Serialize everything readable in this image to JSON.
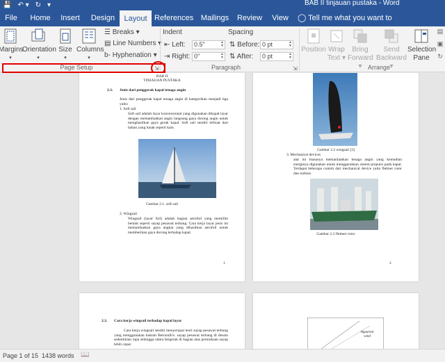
{
  "window": {
    "title": "BAB II tinjauan pustaka - Word"
  },
  "tabs": [
    {
      "label": "File"
    },
    {
      "label": "Home"
    },
    {
      "label": "Insert"
    },
    {
      "label": "Design"
    },
    {
      "label": "Layout"
    },
    {
      "label": "References"
    },
    {
      "label": "Mailings"
    },
    {
      "label": "Review"
    },
    {
      "label": "View"
    }
  ],
  "tellme": "Tell me what you want to do",
  "ribbon": {
    "page_setup": {
      "margins": "Margins",
      "orientation": "Orientation",
      "size": "Size",
      "columns": "Columns",
      "breaks": "Breaks",
      "line_numbers": "Line Numbers",
      "hyphenation": "Hyphenation",
      "label": "Page Setup"
    },
    "paragraph": {
      "indent": "Indent",
      "left_label": "Left:",
      "left_value": "0.5\"",
      "right_label": "Right:",
      "right_value": "0\"",
      "spacing": "Spacing",
      "before_label": "Before:",
      "before_value": "0 pt",
      "after_label": "After:",
      "after_value": "0 pt",
      "label": "Paragraph"
    },
    "arrange": {
      "position": "Position",
      "wrap": "Wrap",
      "wrap2": "Text",
      "bring": "Bring",
      "bring2": "Forward",
      "send": "Send",
      "send2": "Backward",
      "selection": "Selection",
      "selection2": "Pane",
      "label": "Arrange"
    }
  },
  "pages": {
    "p1": {
      "heading1": "BAB II",
      "heading2": "TINJAUAN PUSTAKA",
      "sec_num": "2.3.",
      "sec_title": "Jenis dari penggerak kapal tenaga angin",
      "intro": "Jenis dari penggerak kapal tenaga angin di kategorikan menjadi tiga yaitu:",
      "item1": "1.   Soft sail",
      "item1_text": "Soft sail adalah layar konvensional yang digunakan dikapal layar dengan memanfaatkan angin langsung gaya dorong angin untuk menghasilkan gaya gerak kapal. Soft sail sendiri terbuat dari bahan yang lunak seperti kain.",
      "caption1": "Gambar 2.1. soft sail",
      "item2": "2.   Wingsail",
      "item2_text": "Wingsail (layar foil) adalah bagian aerofoil yang memiliki bentuk seperti sayap pesawat terbang. Cara kerja layar jenis ini memanfaatkan gaya angkat yang dihasilkan aerofoil untuk memberikan gaya dorong terhadap kapal.",
      "page_num": "1"
    },
    "p2": {
      "caption2": "Gambar 2.2 wingsail [3]",
      "item3": "3.   Mechanical devices",
      "item3_text": "alat ini biasanya memanfaatkan tenaga angin yang kemudian energinya digunakan untuk menggerakkan sistem propulsi pada kapal. Terdapat beberapa contoh dari mechanical device yaitu flettner rotor dan turbine.",
      "caption3": "Gambar 2.3 flettner rotor",
      "page_num": "2"
    },
    "p3": {
      "sec_num": "2.3.",
      "sec_title": "Cara kerja wingsail terhadap kapal layar",
      "text": "Cara kerja wingsail sendiri menyerupai teori sayap pesawat terbang yang menggunakan hukum Bernoulli's. sayap pesawat terbang di desain sedemikian rupa sehingga udara bergerak di bagian atas permukaan sayap lebih cepat"
    },
    "p4": {
      "diagram_label": "Apparent wind"
    }
  },
  "status": {
    "page": "Page 1 of 15",
    "words": "1438 words"
  },
  "colors": {
    "accent": "#2b579a",
    "highlight": "#e00000"
  }
}
